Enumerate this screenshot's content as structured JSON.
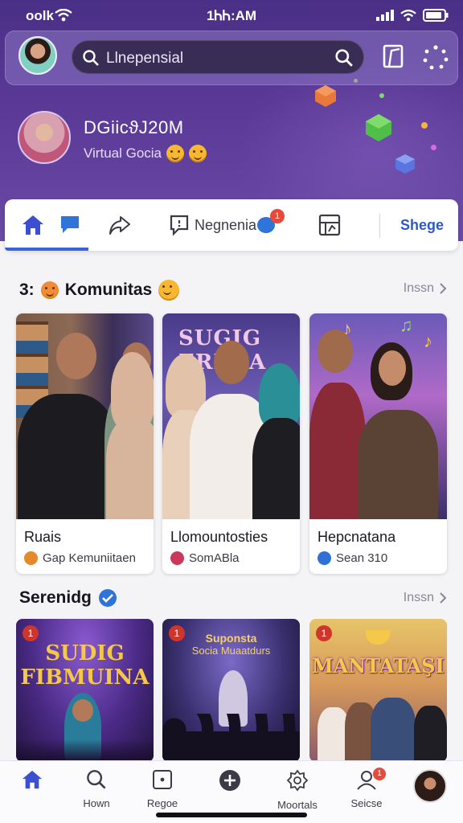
{
  "status_bar": {
    "carrier": "oolk",
    "time": "1ᏂᏂ:AM"
  },
  "search": {
    "value": "Llnepensial"
  },
  "profile": {
    "name": "DGiicϑJ20M",
    "subtitle": "Virtual Gocia"
  },
  "tabs": {
    "label": "Negnenia",
    "badge": "1",
    "right_label": "Shege"
  },
  "communities": {
    "heading_number": "3:",
    "heading": "Komunitas",
    "see_all": "Inssn",
    "cards": [
      {
        "title": "Ruais",
        "subtitle": "Gap Kemuniitaen",
        "badge_color": "#e48a2a"
      },
      {
        "title": "Llomountosties",
        "subtitle": "SomABla",
        "badge_color": "#c9395e"
      },
      {
        "title": "Hepcnatana",
        "subtitle": "Sean 310",
        "badge_color": "#2f6fd6"
      }
    ],
    "banner_text": "SUGIG ERNSA"
  },
  "trending": {
    "heading": "Serenidg",
    "see_all": "Inssn",
    "cards": [
      {
        "number": "1",
        "title_line1": "SUDIG",
        "title_line2": "FIBMUINA"
      },
      {
        "number": "1",
        "title_line1": "Suponsta",
        "title_line2": "Socia Muaatdurs"
      },
      {
        "number": "1",
        "title_line1": "MANTATAŞI",
        "title_line2": ""
      }
    ]
  },
  "bottom_nav": {
    "items": [
      {
        "label": "",
        "icon": "home-icon"
      },
      {
        "label": "Hown",
        "icon": "search-icon"
      },
      {
        "label": "Regoe",
        "icon": "square-icon"
      },
      {
        "label": "",
        "icon": "plus-icon"
      },
      {
        "label": "Moortals",
        "icon": "gear-icon"
      },
      {
        "label": "Seicse",
        "icon": "user-icon",
        "badge": "1"
      }
    ]
  },
  "colors": {
    "primary": "#3b63d8",
    "header": "#4a2f86",
    "badge": "#e7493b"
  }
}
